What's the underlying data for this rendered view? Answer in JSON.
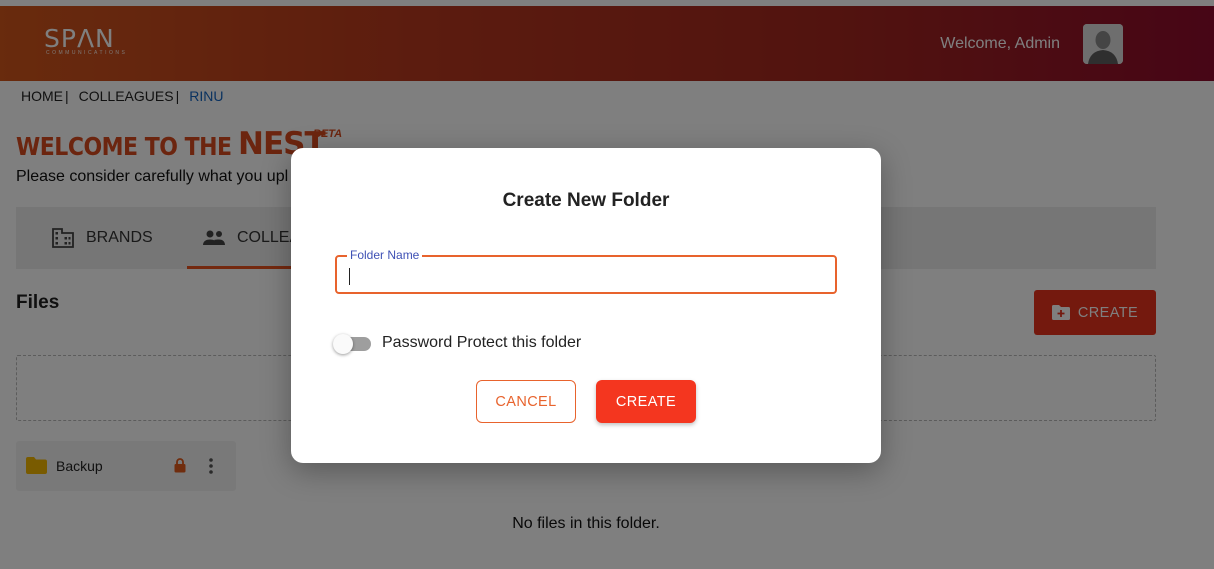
{
  "header": {
    "logo_main": "SPΛN",
    "logo_sub": "COMMUNICATIONS",
    "welcome_text": "Welcome, Admin",
    "gradient_colors": [
      "#d2561b",
      "#8e0b2c"
    ]
  },
  "breadcrumb": {
    "items": [
      "HOME",
      "COLLEAGUES"
    ],
    "separator": "|",
    "current": "RINU"
  },
  "banner": {
    "welcome": "WELCOME TO THE",
    "nest": "NEST",
    "beta": "BETA",
    "notice": "Please consider carefully what you upl"
  },
  "tabs": [
    {
      "label": "BRANDS",
      "icon": "building-icon"
    },
    {
      "label": "COLLEA",
      "icon": "people-icon",
      "active": true
    }
  ],
  "files": {
    "title": "Files",
    "create_label": "CREATE",
    "folders": [
      {
        "name": "Backup",
        "locked": true
      }
    ],
    "empty_message": "No files in this folder."
  },
  "dialog": {
    "title": "Create New Folder",
    "field_label": "Folder Name",
    "field_value": "",
    "toggle_label": "Password Protect this folder",
    "toggle_on": false,
    "cancel_label": "CANCEL",
    "create_label": "CREATE"
  },
  "colors": {
    "accent": "#e8632d",
    "primary_button": "#f4361f",
    "label_blue": "#3f51b5",
    "breadcrumb_current": "#1565c0"
  }
}
